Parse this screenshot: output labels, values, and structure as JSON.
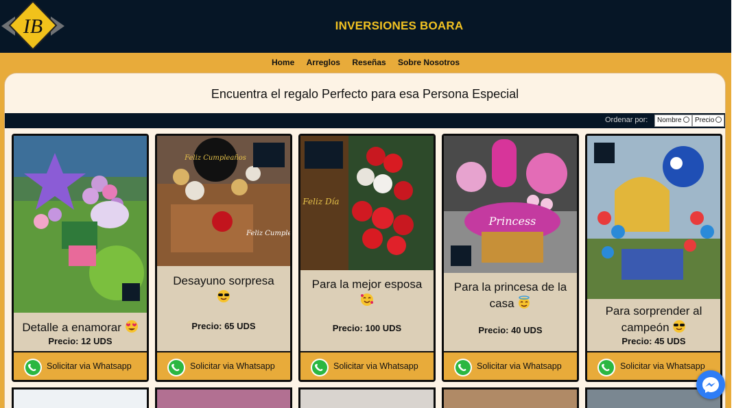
{
  "header": {
    "brand": "INVERSIONES BOARA",
    "logo_text": "IB"
  },
  "nav": [
    {
      "label": "Home"
    },
    {
      "label": "Arreglos"
    },
    {
      "label": "Reseñas"
    },
    {
      "label": "Sobre Nosotros"
    }
  ],
  "main": {
    "headline": "Encuentra el regalo Perfecto para esa Persona Especial",
    "sort": {
      "label": "Ordenar por:",
      "options": [
        "Nombre",
        "Precio"
      ]
    }
  },
  "products": [
    {
      "title": "Detalle a enamorar",
      "emoji": "heart-eyes",
      "price": "Precio: 12 UDS",
      "cta": "Solicitar via Whatsapp"
    },
    {
      "title": "Desayuno sorpresa",
      "emoji": "sunglasses",
      "price": "Precio: 65 UDS",
      "cta": "Solicitar via Whatsapp",
      "photo_text": "Feliz Cumpleaños"
    },
    {
      "title": "Para la mejor esposa",
      "emoji": "hearts",
      "price": "Precio: 100 UDS",
      "cta": "Solicitar via Whatsapp",
      "photo_text": "Feliz Día"
    },
    {
      "title": "Para la princesa de la casa",
      "emoji": "halo",
      "price": "Precio: 40 UDS",
      "cta": "Solicitar via Whatsapp",
      "photo_text": "Princess"
    },
    {
      "title": "Para sorprender al campeón",
      "emoji": "sunglasses",
      "price": "Precio: 45 UDS",
      "cta": "Solicitar via Whatsapp"
    }
  ]
}
